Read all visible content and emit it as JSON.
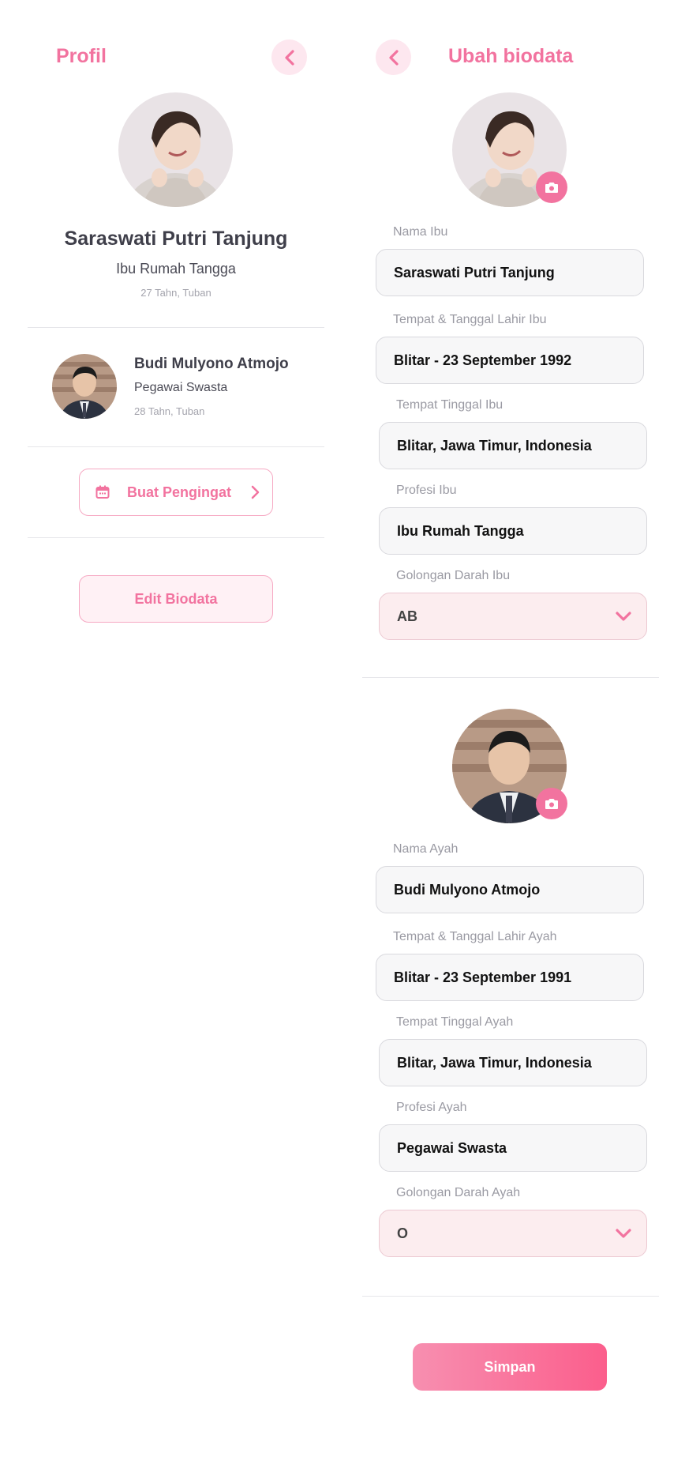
{
  "profile": {
    "title": "Profil",
    "mother": {
      "name": "Saraswati Putri Tanjung",
      "job": "Ibu Rumah Tangga",
      "age_city": "27 Tahn, Tuban"
    },
    "father": {
      "name": "Budi Mulyono Atmojo",
      "job": "Pegawai Swasta",
      "age_city": "28 Tahn, Tuban"
    },
    "reminder_label": "Buat Pengingat",
    "edit_label": "Edit Biodata"
  },
  "edit": {
    "title": "Ubah biodata",
    "mother_fields": {
      "name_label": "Nama Ibu",
      "name_value": "Saraswati Putri Tanjung",
      "birth_label": "Tempat & Tanggal Lahir Ibu",
      "birth_value": "Blitar - 23 September 1992",
      "address_label": "Tempat Tinggal Ibu",
      "address_value": "Blitar, Jawa Timur, Indonesia",
      "job_label": "Profesi Ibu",
      "job_value": "Ibu Rumah Tangga",
      "blood_label": "Golongan Darah Ibu",
      "blood_value": "AB"
    },
    "father_fields": {
      "name_label": "Nama Ayah",
      "name_value": "Budi Mulyono Atmojo",
      "birth_label": "Tempat & Tanggal Lahir Ayah",
      "birth_value": "Blitar - 23 September 1991",
      "address_label": "Tempat Tinggal Ayah",
      "address_value": "Blitar, Jawa Timur, Indonesia",
      "job_label": "Profesi Ayah",
      "job_value": "Pegawai Swasta",
      "blood_label": "Golongan Darah Ayah",
      "blood_value": "O"
    },
    "save_label": "Simpan"
  },
  "icons": {
    "back": "chevron-left-icon",
    "camera": "camera-icon",
    "calendar": "calendar-icon",
    "chevron_right": "chevron-right-icon",
    "dropdown": "chevron-down-icon"
  },
  "colors": {
    "accent": "#f2739f",
    "accent_light": "#fde7ef",
    "field_bg": "#f7f7f8",
    "select_bg": "#fcedef"
  }
}
